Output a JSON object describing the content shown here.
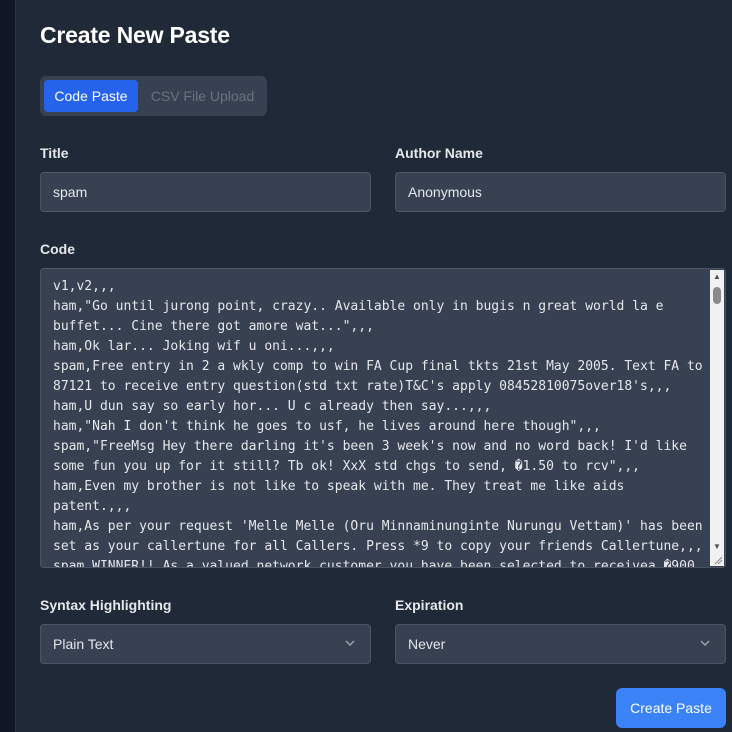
{
  "page": {
    "title": "Create New Paste"
  },
  "tabs": [
    {
      "label": "Code Paste",
      "active": true
    },
    {
      "label": "CSV File Upload",
      "active": false
    }
  ],
  "fields": {
    "title": {
      "label": "Title",
      "value": "spam"
    },
    "author": {
      "label": "Author Name",
      "value": "Anonymous"
    },
    "code": {
      "label": "Code",
      "value": "v1,v2,,,\nham,\"Go until jurong point, crazy.. Available only in bugis n great world la e\nbuffet... Cine there got amore wat...\",,,\nham,Ok lar... Joking wif u oni...,,,\nspam,Free entry in 2 a wkly comp to win FA Cup final tkts 21st May 2005. Text FA to\n87121 to receive entry question(std txt rate)T&C's apply 08452810075over18's,,,\nham,U dun say so early hor... U c already then say...,,,\nham,\"Nah I don't think he goes to usf, he lives around here though\",,,\nspam,\"FreeMsg Hey there darling it's been 3 week's now and no word back! I'd like\nsome fun you up for it still? Tb ok! XxX std chgs to send, �1.50 to rcv\",,,\nham,Even my brother is not like to speak with me. They treat me like aids\npatent.,,,\nham,As per your request 'Melle Melle (Oru Minnaminunginte Nurungu Vettam)' has been\nset as your callertune for all Callers. Press *9 to copy your friends Callertune,,,\nspam,WINNER!! As a valued network customer you have been selected to receivea �900"
    },
    "syntax": {
      "label": "Syntax Highlighting",
      "value": "Plain Text"
    },
    "expiration": {
      "label": "Expiration",
      "value": "Never"
    }
  },
  "actions": {
    "create_label": "Create Paste"
  },
  "colors": {
    "accent": "#3b82f6",
    "active_tab": "#2563eb",
    "panel": "#1f2937",
    "input_bg": "#374151"
  }
}
